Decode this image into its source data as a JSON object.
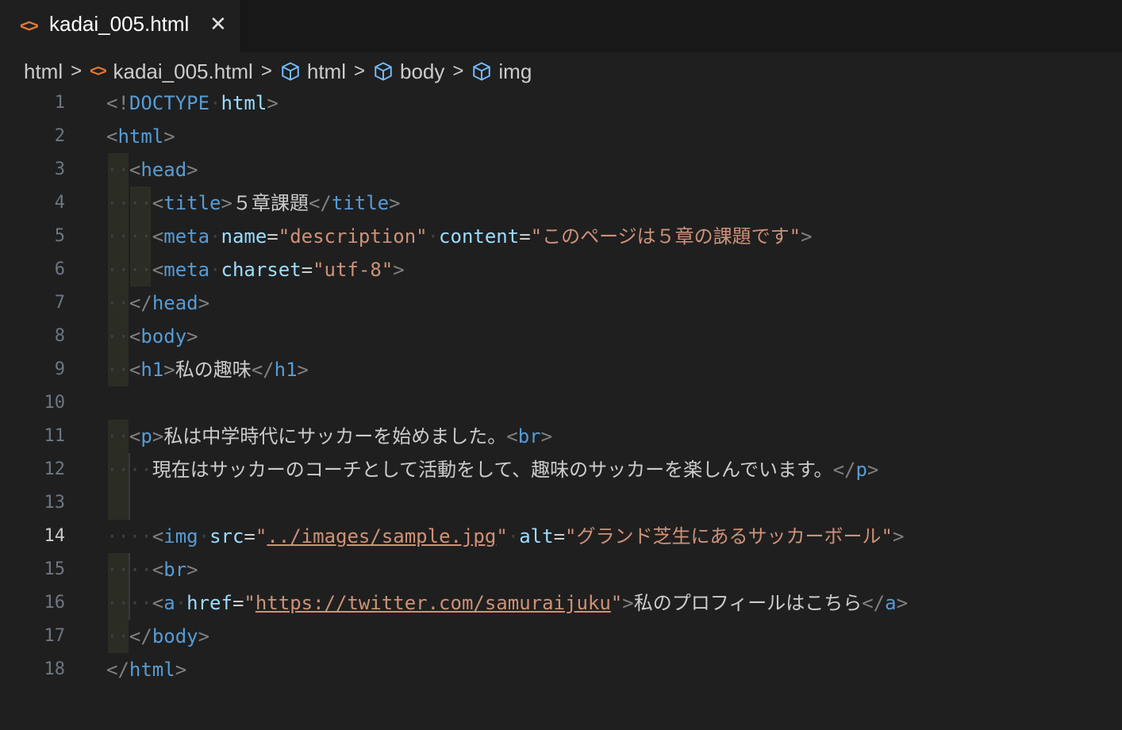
{
  "tab": {
    "icon": "html-file-icon",
    "label": "kadai_005.html",
    "close": "✕"
  },
  "breadcrumb": {
    "items": [
      "html",
      "kadai_005.html",
      "html",
      "body",
      "img"
    ]
  },
  "editor": {
    "active_line": 14,
    "line_numbers": [
      "1",
      "2",
      "3",
      "4",
      "5",
      "6",
      "7",
      "8",
      "9",
      "10",
      "11",
      "12",
      "13",
      "14",
      "15",
      "16",
      "17",
      "18"
    ],
    "lines": {
      "l1": {
        "p1": "<!",
        "p2": "DOCTYPE",
        "p3": "html",
        "p4": ">"
      },
      "l2": {
        "p1": "<",
        "p2": "html",
        "p3": ">"
      },
      "l3": {
        "p1": "<",
        "p2": "head",
        "p3": ">"
      },
      "l4": {
        "p1": "<",
        "p2": "title",
        "p3": ">",
        "p4": "５章課題",
        "p5": "</",
        "p6": "title",
        "p7": ">"
      },
      "l5": {
        "p1": "<",
        "p2": "meta",
        "p3": "name",
        "p4": "=",
        "p5": "\"description\"",
        "p6": "content",
        "p7": "=",
        "p8": "\"このページは５章の課題です\"",
        "p9": ">"
      },
      "l6": {
        "p1": "<",
        "p2": "meta",
        "p3": "charset",
        "p4": "=",
        "p5": "\"utf-8\"",
        "p6": ">"
      },
      "l7": {
        "p1": "</",
        "p2": "head",
        "p3": ">"
      },
      "l8": {
        "p1": "<",
        "p2": "body",
        "p3": ">"
      },
      "l9": {
        "p1": "<",
        "p2": "h1",
        "p3": ">",
        "p4": "私の趣味",
        "p5": "</",
        "p6": "h1",
        "p7": ">"
      },
      "l11": {
        "p1": "<",
        "p2": "p",
        "p3": ">",
        "p4": "私は中学時代にサッカーを始めました。",
        "p5": "<",
        "p6": "br",
        "p7": ">"
      },
      "l12": {
        "p1": "現在はサッカーのコーチとして活動をして、趣味のサッカーを楽しんでいます。",
        "p2": "</",
        "p3": "p",
        "p4": ">"
      },
      "l14": {
        "p1": "<",
        "p2": "img",
        "p3": "src",
        "p4": "=",
        "p5": "\"",
        "p6": "../images/sample.jpg",
        "p7": "\"",
        "p8": "alt",
        "p9": "=",
        "p10": "\"グランド芝生にあるサッカーボール\"",
        "p11": ">"
      },
      "l15": {
        "p1": "<",
        "p2": "br",
        "p3": ">"
      },
      "l16": {
        "p1": "<",
        "p2": "a",
        "p3": "href",
        "p4": "=",
        "p5": "\"",
        "p6": "https://twitter.com/samuraijuku",
        "p7": "\"",
        "p8": ">",
        "p9": "私のプロフィールはこちら",
        "p10": "</",
        "p11": "a",
        "p12": ">"
      },
      "l17": {
        "p1": "</",
        "p2": "body",
        "p3": ">"
      },
      "l18": {
        "p1": "</",
        "p2": "html",
        "p3": ">"
      }
    }
  },
  "colors": {
    "background": "#1f1f1f",
    "tag_name": "#569cd6",
    "attribute": "#9cdcfe",
    "string": "#ce9178",
    "bracket": "#808080",
    "html_icon": "#e37933"
  }
}
